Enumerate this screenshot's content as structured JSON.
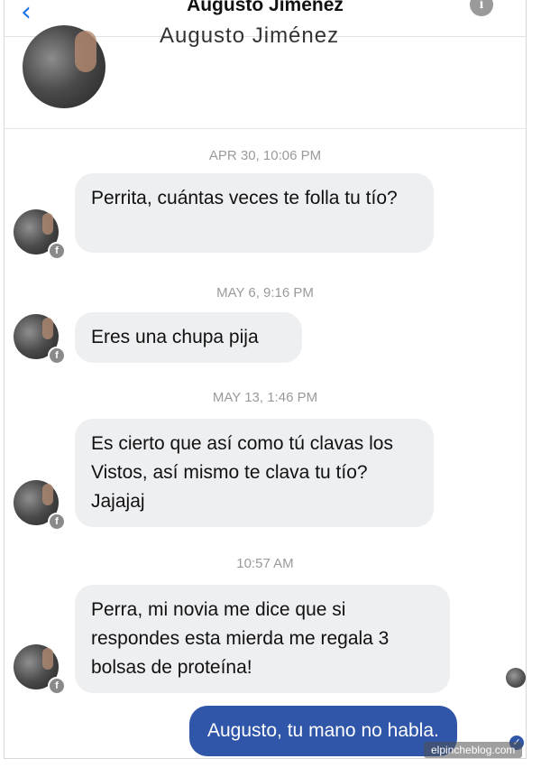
{
  "header": {
    "title": "Augusto Jiménez",
    "back_icon": "chevron-left-icon",
    "info_icon": "info-icon"
  },
  "profile": {
    "name": "Augusto Jiménez"
  },
  "conversation": [
    {
      "timestamp": "APR 30, 10:06 PM",
      "message": "Perrita, cuántas veces te folla tu tío?"
    },
    {
      "timestamp": "MAY 6, 9:16 PM",
      "message": "Eres una chupa pija"
    },
    {
      "timestamp": "MAY 13, 1:46 PM",
      "message": "Es cierto que así como tú clavas los Vistos, así mismo te clava tu tío? Jajajaj"
    },
    {
      "timestamp": "10:57 AM",
      "message": "Perra, mi novia me dice que si respondes esta mierda me regala 3 bolsas de proteína!"
    }
  ],
  "outgoing": {
    "message": "Augusto, tu mano no habla."
  },
  "watermark": "elpincheblog.com",
  "colors": {
    "accent": "#1b74e4",
    "outgoing_bubble": "#2f56a8",
    "incoming_bubble": "#eeeff1",
    "timestamp": "#9a9a9a"
  }
}
